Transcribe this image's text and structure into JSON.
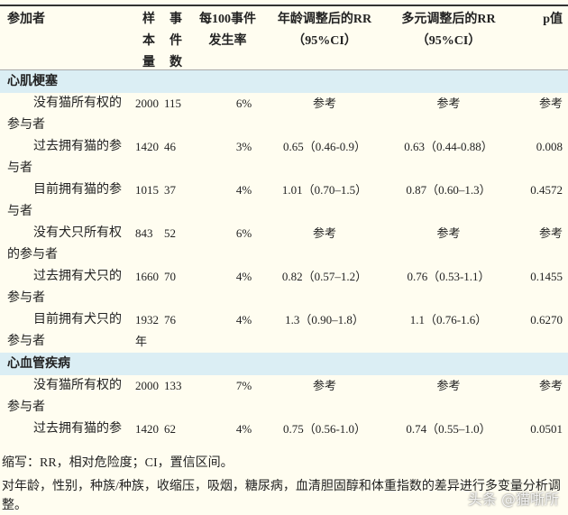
{
  "headers": {
    "participant": "参加者",
    "sample": "样本量",
    "events": "事件数",
    "rate": "每100事件发生率",
    "age_rr": "年龄调整后的RR（95%CI）",
    "multi_rr": "多元调整后的RR（95%CI）",
    "p": "p值"
  },
  "sections": [
    {
      "title": "心肌梗塞",
      "rows": [
        {
          "participant": "没有猫所有权的参与者",
          "sample": "2000",
          "events": "115",
          "rate": "6%",
          "age_rr": "参考",
          "multi_rr": "参考",
          "p": "参考"
        },
        {
          "participant": "过去拥有猫的参与者",
          "sample": "1420",
          "events": "46",
          "rate": "3%",
          "age_rr": "0.65（0.46-0.9）",
          "multi_rr": "0.63（0.44-0.88）",
          "p": "0.008"
        },
        {
          "participant": "目前拥有猫的参与者",
          "sample": "1015",
          "events": "37",
          "rate": "4%",
          "age_rr": "1.01（0.70–1.5）",
          "multi_rr": "0.87（0.60–1.3）",
          "p": "0.4572"
        },
        {
          "participant": "没有犬只所有权的参与者",
          "sample": "843",
          "events": "52",
          "rate": "6%",
          "age_rr": "参考",
          "multi_rr": "参考",
          "p": "参考"
        },
        {
          "participant": "过去拥有犬只的参与者",
          "sample": "1660",
          "events": "70",
          "rate": "4%",
          "age_rr": "0.82（0.57–1.2）",
          "multi_rr": "0.76（0.53-1.1）",
          "p": "0.1455"
        },
        {
          "participant": "目前拥有犬只的参与者",
          "sample": "1932年",
          "events": "76",
          "rate": "4%",
          "age_rr": "1.3（0.90–1.8）",
          "multi_rr": "1.1（0.76-1.6）",
          "p": "0.6270"
        }
      ]
    },
    {
      "title": "心血管疾病",
      "rows": [
        {
          "participant": "没有猫所有权的参与者",
          "sample": "2000",
          "events": "133",
          "rate": "7%",
          "age_rr": "参考",
          "multi_rr": "参考",
          "p": "参考"
        },
        {
          "participant": "过去拥有猫的参",
          "sample": "1420",
          "events": "62",
          "rate": "4%",
          "age_rr": "0.75（0.56-1.0）",
          "multi_rr": "0.74（0.55–1.0）",
          "p": "0.0501"
        }
      ]
    }
  ],
  "footnotes": {
    "abbrev": "缩写：RR，相对危险度；CI，置信区间。",
    "adjust": "对年龄，性别，种族/种族，收缩压，吸烟，糖尿病，血清胆固醇和体重指数的差异进行多变量分析调整。"
  },
  "watermark": "头条 @猫哳所"
}
